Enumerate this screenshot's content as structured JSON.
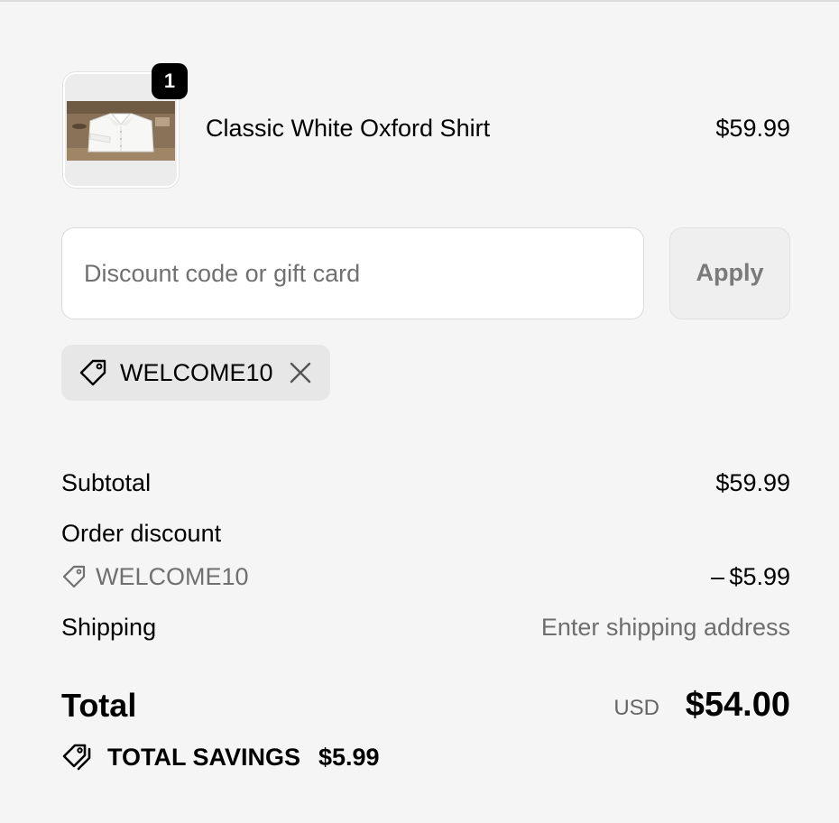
{
  "line_item": {
    "quantity": "1",
    "product_name": "Classic White Oxford Shirt",
    "price": "$59.99",
    "image_icon": "folded-shirt-photo"
  },
  "discount": {
    "placeholder": "Discount code or gift card",
    "value": "",
    "apply_label": "Apply",
    "applied_code": "WELCOME10",
    "tag_icon": "tag-icon",
    "remove_icon": "close-icon"
  },
  "summary": {
    "subtotal_label": "Subtotal",
    "subtotal_value": "$59.99",
    "order_discount_label": "Order discount",
    "discount_code": "WELCOME10",
    "discount_value": "– $5.99",
    "shipping_label": "Shipping",
    "shipping_value": "Enter shipping address",
    "total_label": "Total",
    "currency": "USD",
    "total_value": "$54.00",
    "savings_label": "TOTAL SAVINGS",
    "savings_value": "$5.99",
    "savings_icon": "tags-icon"
  },
  "colors": {
    "background": "#f5f5f5",
    "badge": "#000000",
    "muted_text": "#707070",
    "chip_background": "#e7e7e7"
  }
}
